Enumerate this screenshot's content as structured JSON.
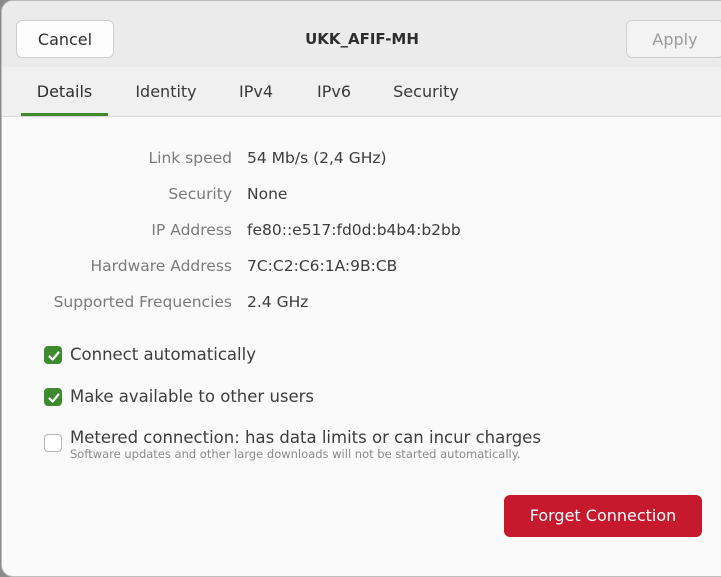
{
  "header": {
    "cancel_label": "Cancel",
    "title": "UKK_AFIF-MH",
    "apply_label": "Apply"
  },
  "tabs": [
    {
      "label": "Details",
      "active": true
    },
    {
      "label": "Identity",
      "active": false
    },
    {
      "label": "IPv4",
      "active": false
    },
    {
      "label": "IPv6",
      "active": false
    },
    {
      "label": "Security",
      "active": false
    }
  ],
  "details": [
    {
      "label": "Link speed",
      "value": "54 Mb/s (2,4 GHz)"
    },
    {
      "label": "Security",
      "value": "None"
    },
    {
      "label": "IP Address",
      "value": "fe80::e517:fd0d:b4b4:b2bb"
    },
    {
      "label": "Hardware Address",
      "value": "7C:C2:C6:1A:9B:CB"
    },
    {
      "label": "Supported Frequencies",
      "value": "2.4 GHz"
    }
  ],
  "options": {
    "connect_auto": {
      "label": "Connect automatically",
      "checked": true
    },
    "available_all": {
      "label": "Make available to other users",
      "checked": true
    },
    "metered": {
      "label": "Metered connection: has data limits or can incur charges",
      "sublabel": "Software updates and other large downloads will not be started automatically.",
      "checked": false
    }
  },
  "forget_label": "Forget Connection",
  "colors": {
    "accent": "#3f8a2e",
    "destructive": "#c7192d"
  },
  "icons": {
    "checkmark": "check-icon"
  }
}
